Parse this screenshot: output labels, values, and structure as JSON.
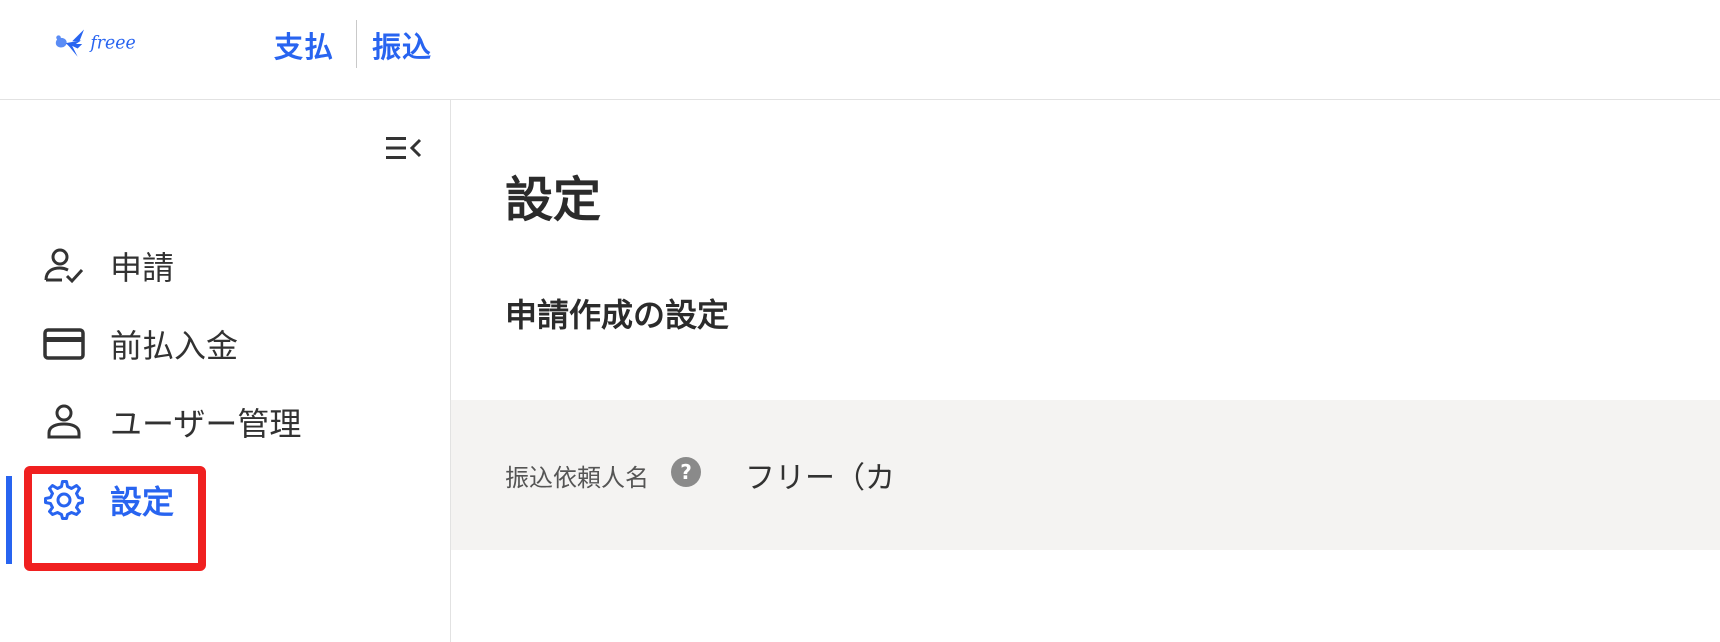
{
  "header": {
    "product_name": "支払",
    "feature_name": "振込"
  },
  "sidebar": {
    "items": [
      {
        "label": "申請",
        "icon": "person-check-icon"
      },
      {
        "label": "前払入金",
        "icon": "credit-card-icon"
      },
      {
        "label": "ユーザー管理",
        "icon": "person-icon"
      },
      {
        "label": "設定",
        "icon": "gear-icon",
        "active": true
      }
    ],
    "collapse_icon": "menu-collapse-icon"
  },
  "main": {
    "page_title": "設定",
    "section_title": "申請作成の設定",
    "setting": {
      "label": "振込依頼人名",
      "help_icon_glyph": "?",
      "value": "フリー（カ"
    }
  },
  "colors": {
    "accent": "#2864f0",
    "highlight": "#f02020",
    "row_background": "#f4f3f2"
  }
}
